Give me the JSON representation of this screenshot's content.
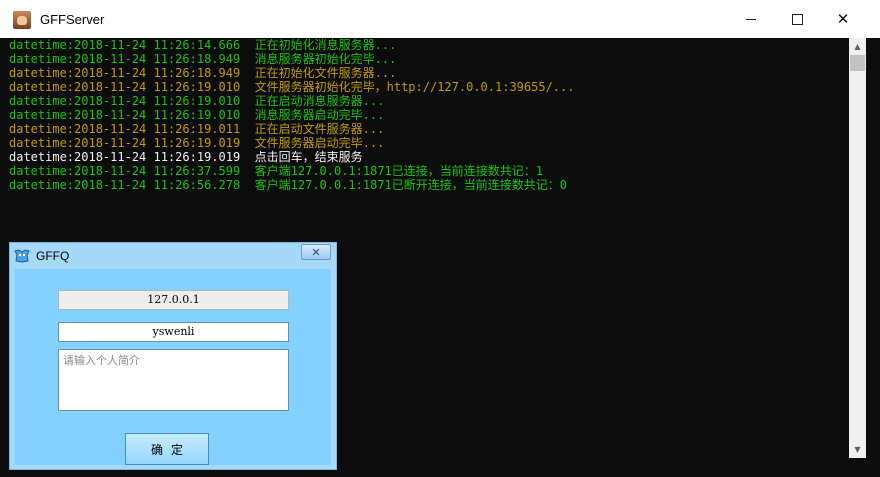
{
  "window": {
    "title": "GFFServer",
    "controls": {
      "minimize": "minimize-icon",
      "maximize": "maximize-icon",
      "close": "close-icon"
    }
  },
  "console": {
    "lines": [
      {
        "text": "datetime:2018-11-24 11:26:14.666  正在初始化消息服务器...",
        "color": "#16c60c"
      },
      {
        "text": "datetime:2018-11-24 11:26:18.949  消息服务器初始化完毕...",
        "color": "#16c60c"
      },
      {
        "text": "datetime:2018-11-24 11:26:18.949  正在初始化文件服务器...",
        "color": "#c19c00"
      },
      {
        "text": "datetime:2018-11-24 11:26:19.010  文件服务器初始化完毕，http://127.0.0.1:39655/...",
        "color": "#c19c00"
      },
      {
        "text": "datetime:2018-11-24 11:26:19.010  正在启动消息服务器...",
        "color": "#16c60c"
      },
      {
        "text": "datetime:2018-11-24 11:26:19.010  消息服务器启动完毕...",
        "color": "#16c60c"
      },
      {
        "text": "datetime:2018-11-24 11:26:19.011  正在启动文件服务器...",
        "color": "#c19c00"
      },
      {
        "text": "datetime:2018-11-24 11:26:19.019  文件服务器启动完毕...",
        "color": "#c19c00"
      },
      {
        "text": "datetime:2018-11-24 11:26:19.019  点击回车，结束服务",
        "color": "#f2f2f2"
      },
      {
        "text": "datetime:2018-11-24 11:26:37.599  客户端127.0.0.1:1871已连接，当前连接数共记：1",
        "color": "#16c60c"
      },
      {
        "text": "datetime:2018-11-24 11:26:56.278  客户端127.0.0.1:1871已断开连接，当前连接数共记：0",
        "color": "#16c60c"
      }
    ]
  },
  "dialog": {
    "title": "GFFQ",
    "close_icon": "close-icon",
    "ip_value": "127.0.0.1",
    "name_value": "yswenli",
    "bio_placeholder": "请输入个人简介",
    "confirm_label": "确定"
  },
  "scrollbar": {
    "up_arrow": "▲",
    "down_arrow": "▼"
  }
}
